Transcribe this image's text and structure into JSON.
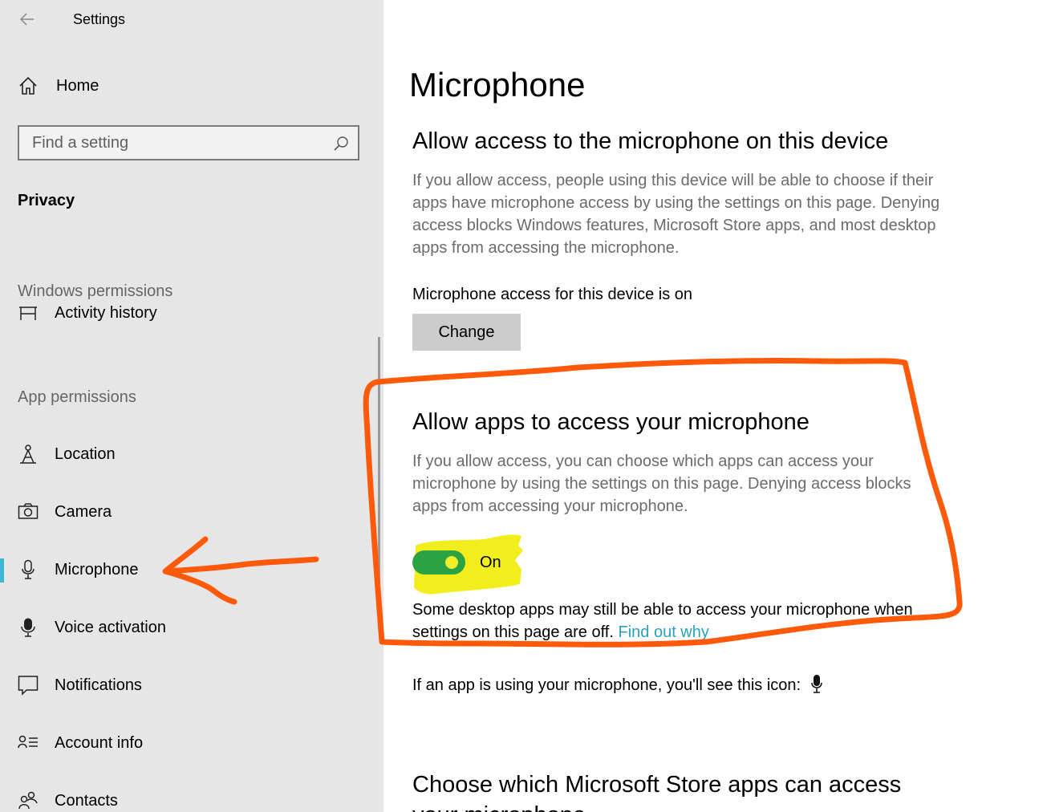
{
  "window": {
    "title": "Settings"
  },
  "sidebar": {
    "home_label": "Home",
    "search_placeholder": "Find a setting",
    "section": "Privacy",
    "windows_permissions_label": "Windows permissions",
    "partial_item": "Activity history",
    "app_permissions_label": "App permissions",
    "items": [
      {
        "label": "Location",
        "icon": "location-icon"
      },
      {
        "label": "Camera",
        "icon": "camera-icon"
      },
      {
        "label": "Microphone",
        "icon": "microphone-icon",
        "active": true
      },
      {
        "label": "Voice activation",
        "icon": "voice-activation-icon"
      },
      {
        "label": "Notifications",
        "icon": "notifications-icon"
      },
      {
        "label": "Account info",
        "icon": "account-info-icon"
      },
      {
        "label": "Contacts",
        "icon": "contacts-icon"
      }
    ]
  },
  "main": {
    "title": "Microphone",
    "device_section": {
      "heading": "Allow access to the microphone on this device",
      "description": "If you allow access, people using this device will be able to choose if their apps have microphone access by using the settings on this page. Denying access blocks Windows features, Microsoft Store apps, and most desktop apps from accessing the microphone.",
      "status": "Microphone access for this device is on",
      "change_button": "Change"
    },
    "apps_section": {
      "heading": "Allow apps to access your microphone",
      "description": "If you allow access, you can choose which apps can access your microphone by using the settings on this page. Denying access blocks apps from accessing your microphone.",
      "toggle_state": "On",
      "toggle_on": true,
      "note": "Some desktop apps may still be able to access your microphone when settings on this page are off.",
      "note_link": "Find out why"
    },
    "icon_note": "If an app is using your microphone, you'll see this icon:",
    "store_section_heading": "Choose which Microsoft Store apps can access your microphone"
  },
  "colors": {
    "sidebar_bg": "#e6e6e6",
    "accent": "#3fb5d8",
    "toggle_on": "#2ca343",
    "link": "#2a9fc4",
    "annotation_orange": "#ff5a0a",
    "annotation_yellow": "#f2ee1e"
  }
}
